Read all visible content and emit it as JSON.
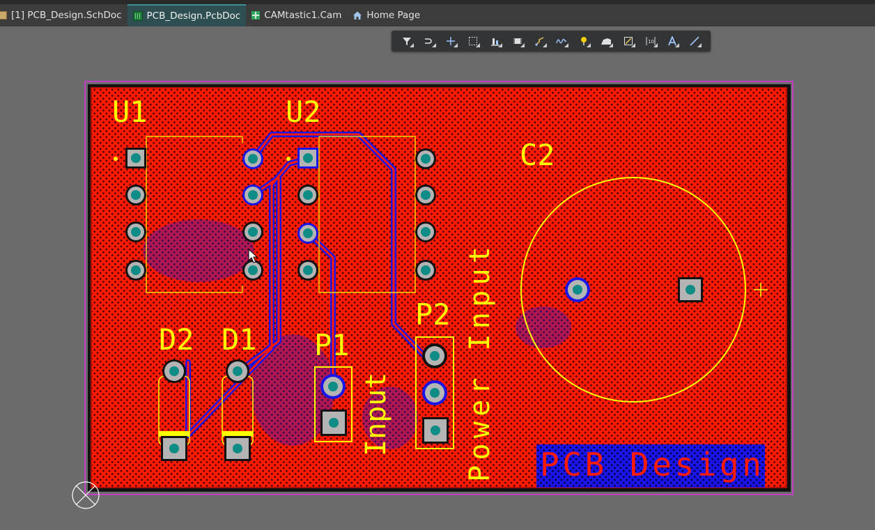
{
  "tabs": [
    {
      "label": "[1] PCB_Design.SchDoc",
      "icon": "schematic-doc-icon",
      "active": false
    },
    {
      "label": "PCB_Design.PcbDoc",
      "icon": "pcb-doc-icon",
      "active": true
    },
    {
      "label": "CAMtastic1.Cam",
      "icon": "cam-doc-icon",
      "active": false
    },
    {
      "label": "Home Page",
      "icon": "home-icon",
      "active": false
    }
  ],
  "toolbar": {
    "tools": [
      "filter-icon",
      "route-interactive-icon",
      "crosshair-icon",
      "select-rect-icon",
      "align-icon",
      "component-icon",
      "route-track-icon",
      "diff-pair-icon",
      "via-pin-icon",
      "polygon-icon",
      "keepout-icon",
      "dimension-icon",
      "text-icon",
      "line-icon"
    ]
  },
  "board": {
    "designators": {
      "u1": "U1",
      "u2": "U2",
      "c2": "C2",
      "d2": "D2",
      "d1": "D1",
      "p1": "P1",
      "p2": "P2"
    },
    "labels": {
      "input": "Input",
      "power_input": "Power Input",
      "pcb_design": "PCB Design"
    },
    "colors": {
      "top_layer": "#ff1a00",
      "bottom_layer": "#1a14e6",
      "silkscreen": "#ffff00",
      "pad": "#b4b4b4",
      "pad_hole": "#0f8c85",
      "board_outline": "#e030e0"
    }
  }
}
